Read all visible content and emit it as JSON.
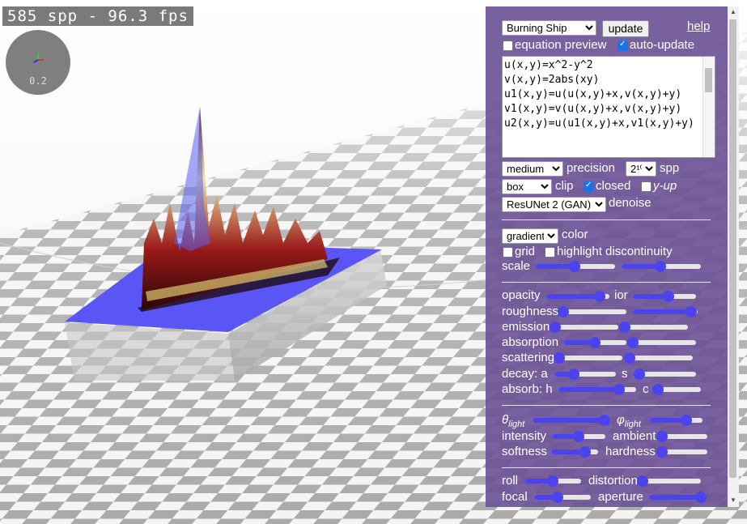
{
  "overlay": {
    "fps_text": "585 spp - 96.3 fps",
    "gizmo_value": "0.2"
  },
  "panel": {
    "function_select": "Burning Ship",
    "update_label": "update",
    "help_label": "help",
    "equation_preview_label": "equation preview",
    "equation_preview_checked": false,
    "auto_update_label": "auto-update",
    "auto_update_checked": true,
    "equation_text": "u(x,y)=x^2-y^2\nv(x,y)=2abs(xy)\nu1(x,y)=u(u(x,y)+x,v(x,y)+y)\nv1(x,y)=v(u(x,y)+x,v(x,y)+y)\nu2(x,y)=u(u1(x,y)+x,v1(x,y)+y)",
    "precision_select": "medium",
    "precision_label": "precision",
    "spp_select": "2¹⁰",
    "spp_label": "spp",
    "clip_select": "box",
    "clip_label": "clip",
    "closed_label": "closed",
    "closed_checked": true,
    "yup_label": "y-up",
    "yup_checked": false,
    "denoise_select": "ResUNet 2 (GAN)",
    "denoise_label": "denoise",
    "color_select": "gradient",
    "color_label": "color",
    "grid_label": "grid",
    "grid_checked": false,
    "highlight_label": "highlight discontinuity",
    "highlight_checked": false,
    "scale_label": "scale",
    "opacity_label": "opacity",
    "ior_label": "ior",
    "roughness_label": "roughness",
    "emission_label": "emission",
    "absorption_label": "absorption",
    "scattering_label": "scattering",
    "decay_label": "decay: a",
    "decay_s_label": "s",
    "absorb_label": "absorb: h",
    "absorb_c_label": "c",
    "theta_symbol": "θ",
    "theta_sub": "light",
    "phi_symbol": "φ",
    "phi_sub": "light",
    "intensity_label": "intensity",
    "ambient_label": "ambient",
    "softness_label": "softness",
    "hardness_label": "hardness",
    "roll_label": "roll",
    "distortion_label": "distortion",
    "focal_label": "focal",
    "aperture_label": "aperture"
  },
  "sliders": {
    "scale_a": 0.49,
    "scale_b": 0.49,
    "opacity": 0.84,
    "ior": 0.57,
    "roughness_a": 0.0,
    "roughness_b": 0.9,
    "emission_a": 0.0,
    "emission_b": 0.0,
    "absorption_a": 0.5,
    "absorption_b": 0.0,
    "scattering_a": 0.0,
    "scattering_b": 0.0,
    "decay_a": 0.32,
    "decay_s": 0.1,
    "absorb_h": 0.78,
    "absorb_c": 0.08,
    "theta_light": 0.93,
    "phi_light": 0.7,
    "intensity": 0.5,
    "ambient": 0.0,
    "softness": 0.72,
    "hardness": 0.0,
    "roll": 0.5,
    "distortion": 0.0,
    "focal": 0.42,
    "aperture": 1.0
  },
  "colors": {
    "panel": "#6c5496",
    "accent": "#4b44ee",
    "surface_blue": "#5050f0"
  }
}
